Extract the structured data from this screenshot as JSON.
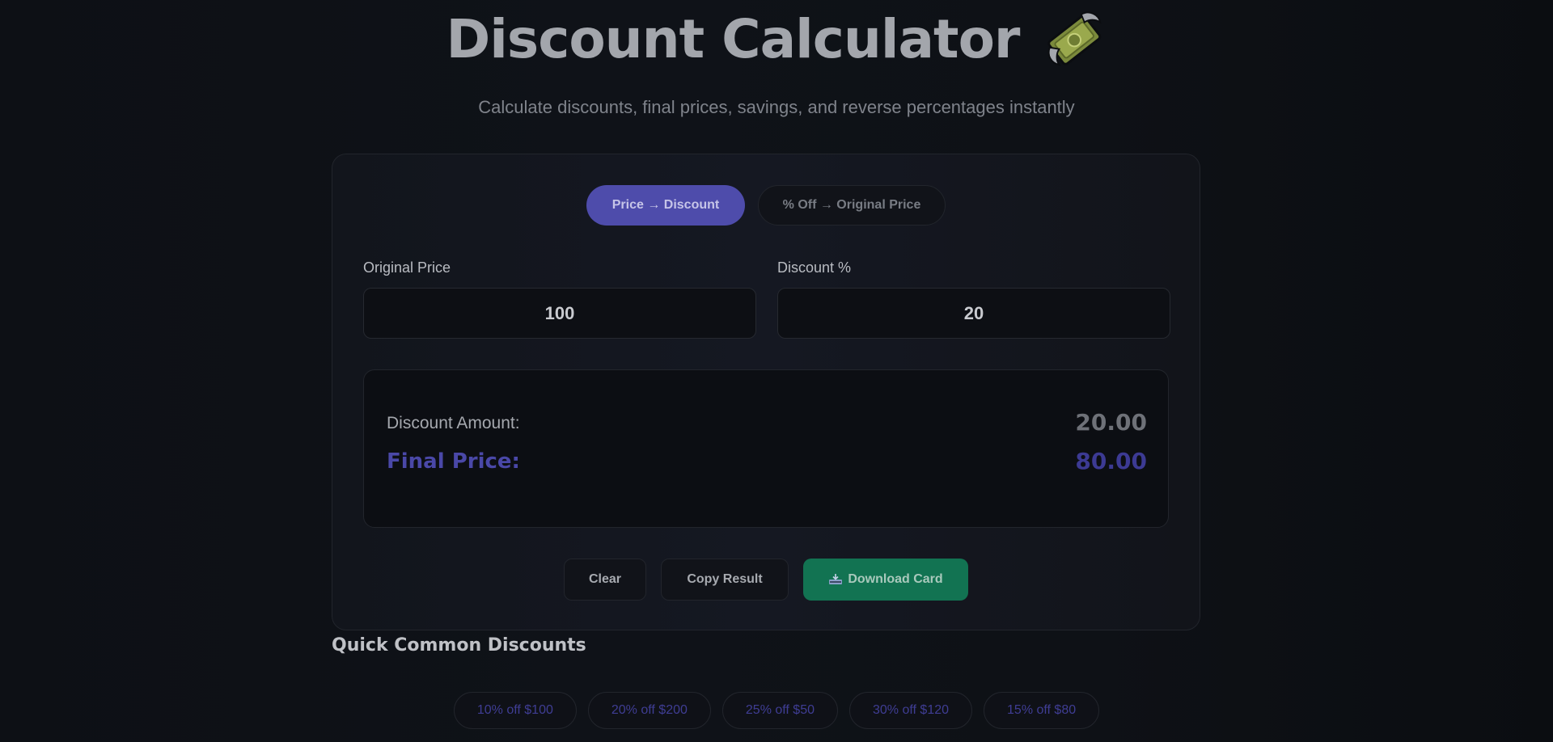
{
  "header": {
    "title": "Discount Calculator",
    "title_icon": "money-with-wings-icon",
    "subtitle": "Calculate discounts, final prices, savings, and reverse percentages instantly"
  },
  "modes": {
    "active_label": "Price → Discount",
    "inactive_label": "% Off → Original Price"
  },
  "fields": {
    "original_price_label": "Original Price",
    "original_price_value": "100",
    "discount_label": "Discount %",
    "discount_value": "20"
  },
  "result": {
    "discount_amount_label": "Discount Amount:",
    "discount_amount_value": "20.00",
    "final_price_label": "Final Price:",
    "final_price_value": "80.00"
  },
  "actions": {
    "clear_label": "Clear",
    "copy_label": "Copy Result",
    "download_label": "Download Card",
    "download_icon": "download-tray-icon"
  },
  "quick": {
    "heading": "Quick Common Discounts",
    "items": [
      "10% off $100",
      "20% off $200",
      "25% off $50",
      "30% off $120",
      "15% off $80"
    ]
  },
  "colors": {
    "accent": "#4e4cab",
    "download": "#127352",
    "final_price": "#4a48a8"
  }
}
